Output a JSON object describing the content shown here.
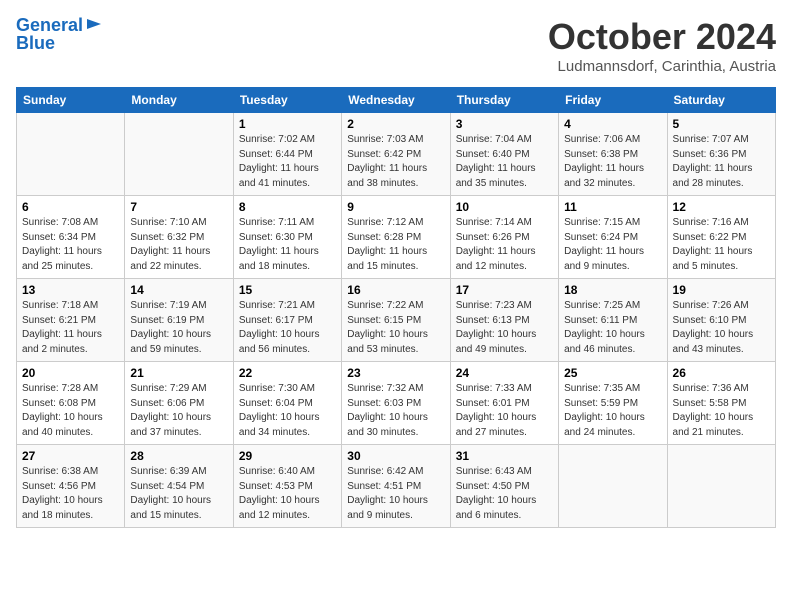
{
  "header": {
    "logo_line1": "General",
    "logo_line2": "Blue",
    "month": "October 2024",
    "location": "Ludmannsdorf, Carinthia, Austria"
  },
  "weekdays": [
    "Sunday",
    "Monday",
    "Tuesday",
    "Wednesday",
    "Thursday",
    "Friday",
    "Saturday"
  ],
  "weeks": [
    [
      {
        "day": "",
        "info": ""
      },
      {
        "day": "",
        "info": ""
      },
      {
        "day": "1",
        "info": "Sunrise: 7:02 AM\nSunset: 6:44 PM\nDaylight: 11 hours\nand 41 minutes."
      },
      {
        "day": "2",
        "info": "Sunrise: 7:03 AM\nSunset: 6:42 PM\nDaylight: 11 hours\nand 38 minutes."
      },
      {
        "day": "3",
        "info": "Sunrise: 7:04 AM\nSunset: 6:40 PM\nDaylight: 11 hours\nand 35 minutes."
      },
      {
        "day": "4",
        "info": "Sunrise: 7:06 AM\nSunset: 6:38 PM\nDaylight: 11 hours\nand 32 minutes."
      },
      {
        "day": "5",
        "info": "Sunrise: 7:07 AM\nSunset: 6:36 PM\nDaylight: 11 hours\nand 28 minutes."
      }
    ],
    [
      {
        "day": "6",
        "info": "Sunrise: 7:08 AM\nSunset: 6:34 PM\nDaylight: 11 hours\nand 25 minutes."
      },
      {
        "day": "7",
        "info": "Sunrise: 7:10 AM\nSunset: 6:32 PM\nDaylight: 11 hours\nand 22 minutes."
      },
      {
        "day": "8",
        "info": "Sunrise: 7:11 AM\nSunset: 6:30 PM\nDaylight: 11 hours\nand 18 minutes."
      },
      {
        "day": "9",
        "info": "Sunrise: 7:12 AM\nSunset: 6:28 PM\nDaylight: 11 hours\nand 15 minutes."
      },
      {
        "day": "10",
        "info": "Sunrise: 7:14 AM\nSunset: 6:26 PM\nDaylight: 11 hours\nand 12 minutes."
      },
      {
        "day": "11",
        "info": "Sunrise: 7:15 AM\nSunset: 6:24 PM\nDaylight: 11 hours\nand 9 minutes."
      },
      {
        "day": "12",
        "info": "Sunrise: 7:16 AM\nSunset: 6:22 PM\nDaylight: 11 hours\nand 5 minutes."
      }
    ],
    [
      {
        "day": "13",
        "info": "Sunrise: 7:18 AM\nSunset: 6:21 PM\nDaylight: 11 hours\nand 2 minutes."
      },
      {
        "day": "14",
        "info": "Sunrise: 7:19 AM\nSunset: 6:19 PM\nDaylight: 10 hours\nand 59 minutes."
      },
      {
        "day": "15",
        "info": "Sunrise: 7:21 AM\nSunset: 6:17 PM\nDaylight: 10 hours\nand 56 minutes."
      },
      {
        "day": "16",
        "info": "Sunrise: 7:22 AM\nSunset: 6:15 PM\nDaylight: 10 hours\nand 53 minutes."
      },
      {
        "day": "17",
        "info": "Sunrise: 7:23 AM\nSunset: 6:13 PM\nDaylight: 10 hours\nand 49 minutes."
      },
      {
        "day": "18",
        "info": "Sunrise: 7:25 AM\nSunset: 6:11 PM\nDaylight: 10 hours\nand 46 minutes."
      },
      {
        "day": "19",
        "info": "Sunrise: 7:26 AM\nSunset: 6:10 PM\nDaylight: 10 hours\nand 43 minutes."
      }
    ],
    [
      {
        "day": "20",
        "info": "Sunrise: 7:28 AM\nSunset: 6:08 PM\nDaylight: 10 hours\nand 40 minutes."
      },
      {
        "day": "21",
        "info": "Sunrise: 7:29 AM\nSunset: 6:06 PM\nDaylight: 10 hours\nand 37 minutes."
      },
      {
        "day": "22",
        "info": "Sunrise: 7:30 AM\nSunset: 6:04 PM\nDaylight: 10 hours\nand 34 minutes."
      },
      {
        "day": "23",
        "info": "Sunrise: 7:32 AM\nSunset: 6:03 PM\nDaylight: 10 hours\nand 30 minutes."
      },
      {
        "day": "24",
        "info": "Sunrise: 7:33 AM\nSunset: 6:01 PM\nDaylight: 10 hours\nand 27 minutes."
      },
      {
        "day": "25",
        "info": "Sunrise: 7:35 AM\nSunset: 5:59 PM\nDaylight: 10 hours\nand 24 minutes."
      },
      {
        "day": "26",
        "info": "Sunrise: 7:36 AM\nSunset: 5:58 PM\nDaylight: 10 hours\nand 21 minutes."
      }
    ],
    [
      {
        "day": "27",
        "info": "Sunrise: 6:38 AM\nSunset: 4:56 PM\nDaylight: 10 hours\nand 18 minutes."
      },
      {
        "day": "28",
        "info": "Sunrise: 6:39 AM\nSunset: 4:54 PM\nDaylight: 10 hours\nand 15 minutes."
      },
      {
        "day": "29",
        "info": "Sunrise: 6:40 AM\nSunset: 4:53 PM\nDaylight: 10 hours\nand 12 minutes."
      },
      {
        "day": "30",
        "info": "Sunrise: 6:42 AM\nSunset: 4:51 PM\nDaylight: 10 hours\nand 9 minutes."
      },
      {
        "day": "31",
        "info": "Sunrise: 6:43 AM\nSunset: 4:50 PM\nDaylight: 10 hours\nand 6 minutes."
      },
      {
        "day": "",
        "info": ""
      },
      {
        "day": "",
        "info": ""
      }
    ]
  ]
}
